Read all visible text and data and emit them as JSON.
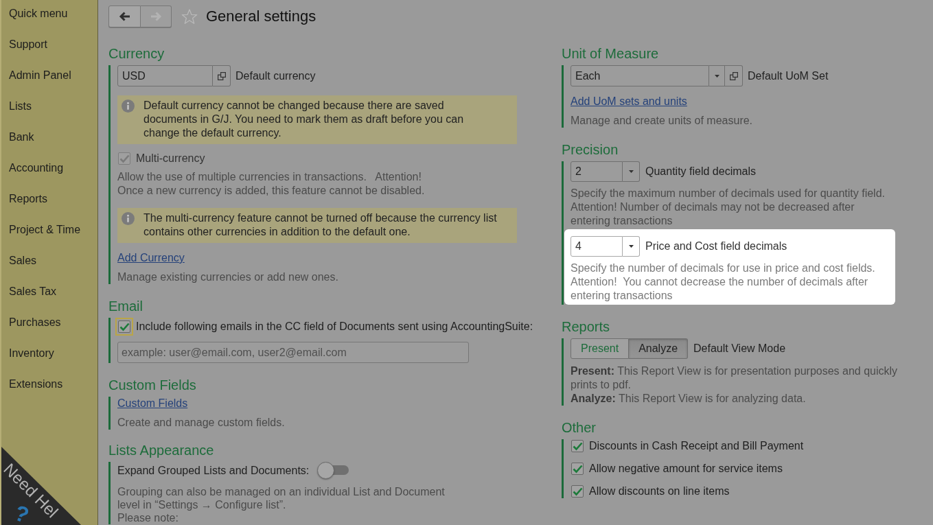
{
  "sidebar": {
    "items": [
      {
        "label": "Quick menu"
      },
      {
        "label": "Support"
      },
      {
        "label": "Admin Panel"
      },
      {
        "label": "Lists"
      },
      {
        "label": "Bank"
      },
      {
        "label": "Accounting"
      },
      {
        "label": "Reports"
      },
      {
        "label": "Project & Time"
      },
      {
        "label": "Sales"
      },
      {
        "label": "Sales Tax"
      },
      {
        "label": "Purchases"
      },
      {
        "label": "Inventory"
      },
      {
        "label": "Extensions"
      }
    ]
  },
  "help_corner": {
    "label": "Need Hel",
    "symbol": "?"
  },
  "header": {
    "back_button": {
      "disabled": false
    },
    "forward_button": {
      "disabled": true
    },
    "favorite": {
      "on": false
    },
    "title": "General settings"
  },
  "columns": [
    {
      "sections": [
        {
          "title": "Currency",
          "items": [
            {
              "kind": "select",
              "value": "USD",
              "dropdown": false,
              "open_button": true,
              "label": "Default currency"
            },
            {
              "kind": "info",
              "text": "Default currency cannot be changed because there are saved\ndocuments in G/J. You need to mark them as draft before you can\nchange the default currency."
            },
            {
              "kind": "checkbox",
              "label": "Multi-currency",
              "checked": true,
              "disabled": true,
              "focused": false
            },
            {
              "kind": "note",
              "text": "Allow the use of multiple currencies in transactions.   Attention!\nOnce a new currency is added, this feature cannot be disabled."
            },
            {
              "kind": "info",
              "text": "The multi-currency feature cannot be turned off because the currency list\ncontains other currencies in addition to the default one."
            },
            {
              "kind": "link",
              "text": "Add Currency"
            },
            {
              "kind": "note",
              "text": "Manage existing currencies or add new ones."
            }
          ]
        },
        {
          "title": "Email",
          "items": [
            {
              "kind": "checkbox",
              "label": "Include following emails in the CC field of Documents sent using AccountingSuite:",
              "checked": true,
              "disabled": false,
              "focused": true
            },
            {
              "kind": "text_input",
              "placeholder": "example: user@email.com, user2@email.com"
            }
          ]
        },
        {
          "title": "Custom Fields",
          "items": [
            {
              "kind": "link",
              "text": "Custom Fields"
            },
            {
              "kind": "note",
              "text": "Create and manage custom fields."
            }
          ]
        },
        {
          "title": "Lists Appearance",
          "items": [
            {
              "kind": "toggle",
              "label": "Expand Grouped Lists and Documents:",
              "on": false
            },
            {
              "kind": "note",
              "text": "Grouping can also be managed on an individual List and Document\nlevel in “Settings → Configure list”."
            },
            {
              "kind": "note",
              "text": "Please note:"
            }
          ]
        }
      ]
    },
    {
      "sections": [
        {
          "title": "Unit of Measure",
          "items": [
            {
              "kind": "select",
              "value": "Each",
              "dropdown": true,
              "open_button": true,
              "label": "Default UoM Set"
            },
            {
              "kind": "link",
              "text": "Add UoM sets and units"
            },
            {
              "kind": "note",
              "text": "Manage and create units of measure."
            }
          ]
        },
        {
          "title": "Precision",
          "items": [
            {
              "kind": "select",
              "value": "2",
              "dropdown": true,
              "open_button": false,
              "label": "Quantity field decimals"
            },
            {
              "kind": "note",
              "text": "Specify the maximum number of decimals used for quantity field.\nAttention! Number of decimals may not be decreased after\nentering transactions"
            },
            {
              "kind": "group",
              "highlighted": true,
              "items": [
                {
                  "kind": "select",
                  "value": "4",
                  "dropdown": true,
                  "open_button": false,
                  "label": "Price and Cost field decimals"
                },
                {
                  "kind": "note",
                  "text": "Specify the number of decimals for use in price and cost fields.\nAttention!  You cannot decrease the number of decimals after\nentering transactions"
                }
              ]
            }
          ]
        },
        {
          "title": "Reports",
          "items": [
            {
              "kind": "segmented",
              "options": [
                {
                  "label": "Present",
                  "selected": false
                },
                {
                  "label": "Analyze",
                  "selected": true
                }
              ],
              "label": "Default View Mode"
            },
            {
              "kind": "note",
              "text": "**Present:** This Report View is for presentation purposes and quickly\nprints to pdf.\n**Analyze:** This Report View is for analyzing data."
            }
          ]
        },
        {
          "title": "Other",
          "items": [
            {
              "kind": "checkbox",
              "label": "Discounts in Cash Receipt and Bill Payment",
              "checked": true,
              "disabled": false,
              "focused": false
            },
            {
              "kind": "checkbox",
              "label": "Allow negative amount for service items",
              "checked": true,
              "disabled": false,
              "focused": false
            },
            {
              "kind": "checkbox",
              "label": "Allow discounts on line items",
              "checked": true,
              "disabled": false,
              "focused": false
            }
          ]
        }
      ]
    }
  ]
}
